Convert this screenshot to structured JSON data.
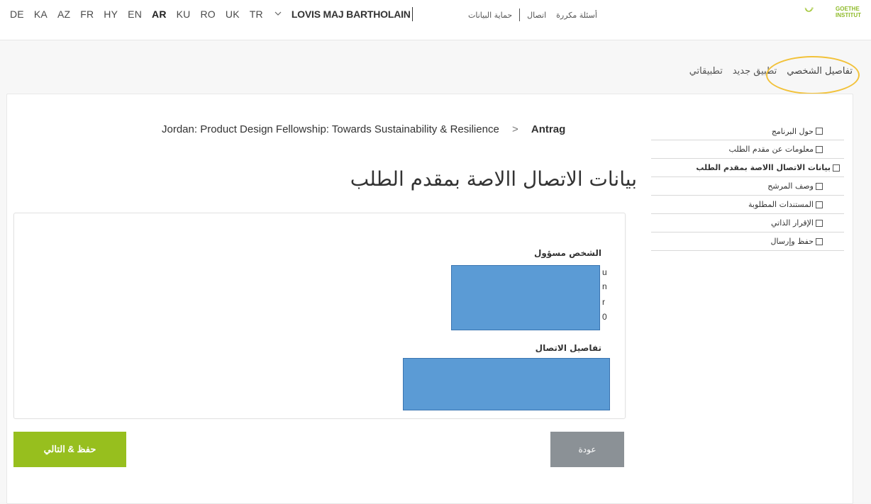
{
  "header": {
    "languages": [
      {
        "code": "DE",
        "active": false
      },
      {
        "code": "KA",
        "active": false
      },
      {
        "code": "AZ",
        "active": false
      },
      {
        "code": "FR",
        "active": false
      },
      {
        "code": "HY",
        "active": false
      },
      {
        "code": "EN",
        "active": false
      },
      {
        "code": "AR",
        "active": true
      },
      {
        "code": "KU",
        "active": false
      },
      {
        "code": "RO",
        "active": false
      },
      {
        "code": "UK",
        "active": false
      },
      {
        "code": "TR",
        "active": false
      }
    ],
    "user_name": "LOVIS MAJ BARTHOLAIN",
    "links": {
      "privacy": "حماية البيانات",
      "contact": "اتصال",
      "faq": "أسئلة مكررة"
    },
    "logo": {
      "text_line1": "GOETHE",
      "text_line2": "INSTITUT",
      "color": "#8fbb2a"
    }
  },
  "tabs": [
    {
      "label": "تفاصيل الشخصي"
    },
    {
      "label": "تطبيق جديد"
    },
    {
      "label": "تطبيقاتي"
    }
  ],
  "breadcrumb": {
    "current": "Antrag",
    "separator": ">",
    "program": "Jordan: Product Design Fellowship: Towards Sustainability & Resilience"
  },
  "steps": [
    {
      "label": "حول البرنامج",
      "active": false
    },
    {
      "label": "معلومات عن مقدم الطلب",
      "active": false
    },
    {
      "label": "بيانات الاتصال االاصة بمقدم الطلب",
      "active": true
    },
    {
      "label": "وصف المرشح",
      "active": false
    },
    {
      "label": "المستندات المطلوبة",
      "active": false
    },
    {
      "label": "الإقرار الذاتي",
      "active": false
    },
    {
      "label": "حفظ وإرسال",
      "active": false
    }
  ],
  "page_title": "بيانات الاتصال االاصة بمقدم الطلب",
  "form": {
    "responsible_person_label": "الشخص مسؤول",
    "responsible_person_peek": [
      "u",
      "n",
      "r",
      "0"
    ],
    "contact_details_label": "تفاصيل الاتصال"
  },
  "buttons": {
    "next": "حفظ & التالي",
    "back": "عودة"
  },
  "colors": {
    "accent_green": "#97bf1e",
    "back_gray": "#8b9196",
    "redaction_blue": "#5b9bd5",
    "highlight_yellow": "#f2c23a"
  }
}
